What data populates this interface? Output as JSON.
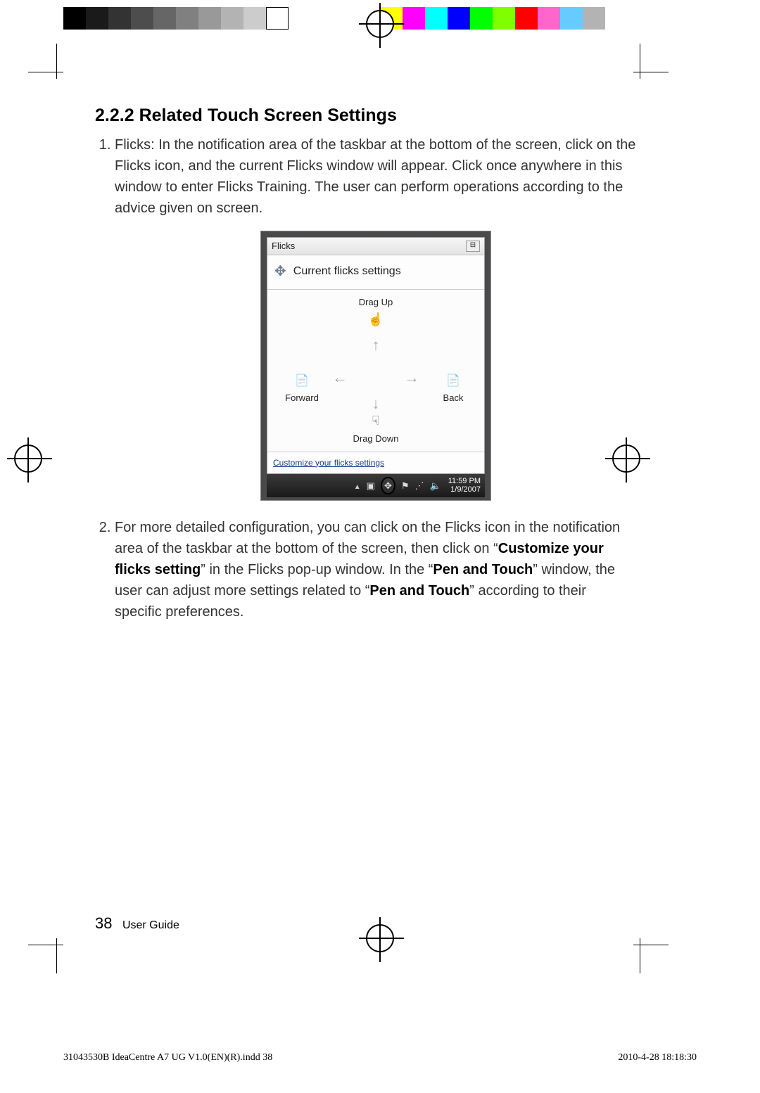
{
  "section": {
    "number": "2.2.2",
    "title": "Related Touch Screen Settings"
  },
  "list": {
    "item1": "Flicks: In the notification area of the taskbar at the bottom of the screen, click on the Flicks icon, and the current Flicks window will appear. Click once anywhere in this window to enter Flicks Training. The user can perform operations according to the advice given on screen.",
    "item2_a": "For more detailed configuration, you can click on the Flicks icon in the notification area of the taskbar at the bottom of the screen, then click on “",
    "item2_b1": "Customize your flicks setting",
    "item2_c": "” in the Flicks pop-up window. In the “",
    "item2_b2": "Pen and Touch",
    "item2_d": "” window, the user can adjust more settings related to “",
    "item2_b3": "Pen and Touch",
    "item2_e": "” according to their specific preferences."
  },
  "screenshot": {
    "window_title": "Flicks",
    "header": "Current flicks settings",
    "dir_up": "Drag Up",
    "dir_down": "Drag Down",
    "dir_left": "Forward",
    "dir_right": "Back",
    "customize_link": "Customize your flicks settings",
    "time": "11:59 PM",
    "date": "1/9/2007"
  },
  "footer": {
    "page_number": "38",
    "guide_label": "User Guide"
  },
  "slug": {
    "file": "31043530B IdeaCentre A7 UG V1.0(EN)(R).indd   38",
    "timestamp": "2010-4-28   18:18:30"
  }
}
